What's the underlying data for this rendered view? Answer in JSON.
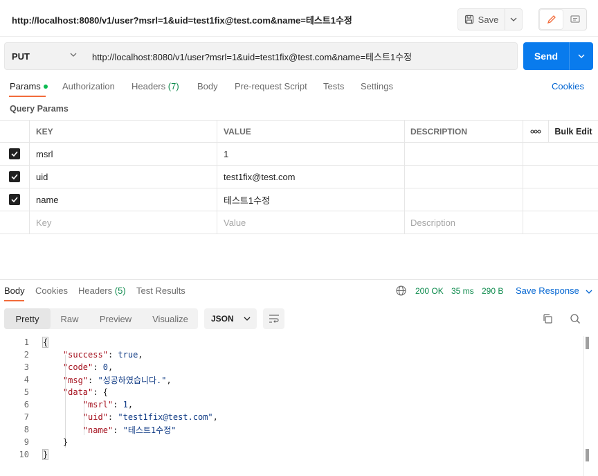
{
  "header": {
    "title": "http://localhost:8080/v1/user?msrl=1&uid=test1fix@test.com&name=테스트1수정",
    "save_label": "Save"
  },
  "request": {
    "method": "PUT",
    "url": "http://localhost:8080/v1/user?msrl=1&uid=test1fix@test.com&name=테스트1수정",
    "send_label": "Send"
  },
  "request_tabs": {
    "params": "Params",
    "authorization": "Authorization",
    "headers": "Headers",
    "headers_count": "(7)",
    "body": "Body",
    "prerequest": "Pre-request Script",
    "tests": "Tests",
    "settings": "Settings",
    "cookies": "Cookies"
  },
  "query_params": {
    "title": "Query Params",
    "columns": {
      "key": "KEY",
      "value": "VALUE",
      "description": "DESCRIPTION",
      "bulk_edit": "Bulk Edit"
    },
    "rows": [
      {
        "key": "msrl",
        "value": "1",
        "description": ""
      },
      {
        "key": "uid",
        "value": "test1fix@test.com",
        "description": ""
      },
      {
        "key": "name",
        "value": "테스트1수정",
        "description": ""
      }
    ],
    "placeholders": {
      "key": "Key",
      "value": "Value",
      "description": "Description"
    }
  },
  "response_tabs": {
    "body": "Body",
    "cookies": "Cookies",
    "headers": "Headers",
    "headers_count": "(5)",
    "test_results": "Test Results"
  },
  "response_status": {
    "status": "200 OK",
    "time": "35 ms",
    "size": "290 B",
    "save_response": "Save Response"
  },
  "view": {
    "modes": [
      "Pretty",
      "Raw",
      "Preview",
      "Visualize"
    ],
    "active_mode": "Pretty",
    "format": "JSON"
  },
  "code_lines": [
    "1",
    "2",
    "3",
    "4",
    "5",
    "6",
    "7",
    "8",
    "9",
    "10"
  ],
  "response_json": {
    "open_brace": "{",
    "success_key": "\"success\"",
    "success_val": "true",
    "code_key": "\"code\"",
    "code_val": "0",
    "msg_key": "\"msg\"",
    "msg_val": "\"성공하였습니다.\"",
    "data_key": "\"data\"",
    "msrl_key": "\"msrl\"",
    "msrl_val": "1",
    "uid_key": "\"uid\"",
    "uid_val": "\"test1fix@test.com\"",
    "name_key": "\"name\"",
    "name_val": "\"테스트1수정\"",
    "inner_close": "}",
    "close_brace": "}"
  }
}
